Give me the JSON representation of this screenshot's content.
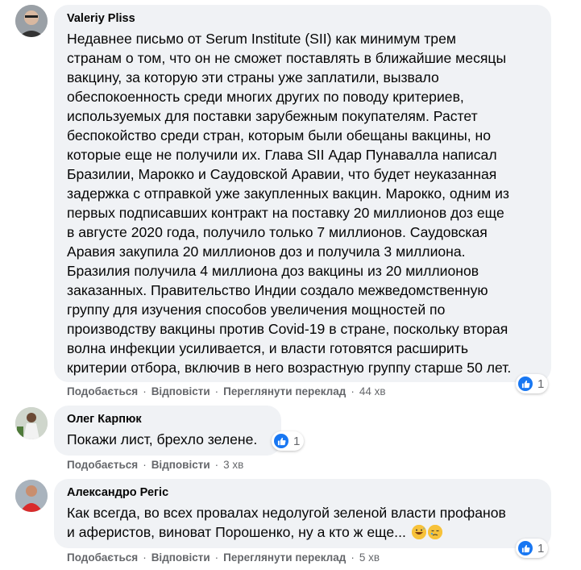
{
  "comments": [
    {
      "author": "Valeriy Pliss",
      "text": "Недавнее письмо от Serum Institute (SII) как минимум трем\nстранам о том, что он не сможет поставлять в ближайшие месяцы\nвакцину, за которую эти страны уже заплатили, вызвало\nобеспокоенность среди многих других по поводу критериев,\nиспользуемых для поставки зарубежным покупателям. Растет\nбеспокойство среди стран, которым были обещаны вакцины, но\nкоторые еще не получили их. Глава SII Адар Пунавалла написал\nБразилии, Марокко и Саудовской Аравии, что будет неуказанная\nзадержка с отправкой уже закупленных вакцин. Марокко, одним из\nпервых подписавших контракт на поставку 20 миллионов доз еще\nв августе 2020 года, получило только 7 миллионов. Саудовская\nАравия закупила 20 миллионов доз и получила 3 миллиона.\nБразилия получила 4 миллиона доз вакцины из 20 миллионов\nзаказанных. Правительство Индии создало межведомственную\nгруппу для изучения способов увеличения мощностей по\nпроизводству вакцины против Covid-19 в стране, поскольку вторая\nволна инфекции усиливается, и власти готовятся расширить\nкритерии отбора, включив в него возрастную группу старше 50 лет.",
      "reaction_count": "1",
      "actions": {
        "like": "Подобається",
        "reply": "Відповісти",
        "translate": "Переглянути переклад",
        "time": "44 хв"
      }
    },
    {
      "author": "Олег Карпюк",
      "text": "Покажи лист, брехло зелене.",
      "reaction_count": "1",
      "actions": {
        "like": "Подобається",
        "reply": "Відповісти",
        "time": "3 хв"
      }
    },
    {
      "author": "Александро Регіс",
      "text": "Как всегда, во всех провалах недолугой зеленой власти профанов\nи аферистов, виноват Порошенко, ну а кто ж еще...",
      "emojis": [
        "grinning-sweat-emoji",
        "sleepy-face-emoji"
      ],
      "reaction_count": "1",
      "actions": {
        "like": "Подобається",
        "reply": "Відповісти",
        "translate": "Переглянути переклад",
        "time": "5 хв"
      }
    }
  ],
  "separator": "·",
  "colors": {
    "bubble": "#f0f2f5",
    "like_blue": "#1877f2",
    "meta_gray": "#65676b"
  }
}
